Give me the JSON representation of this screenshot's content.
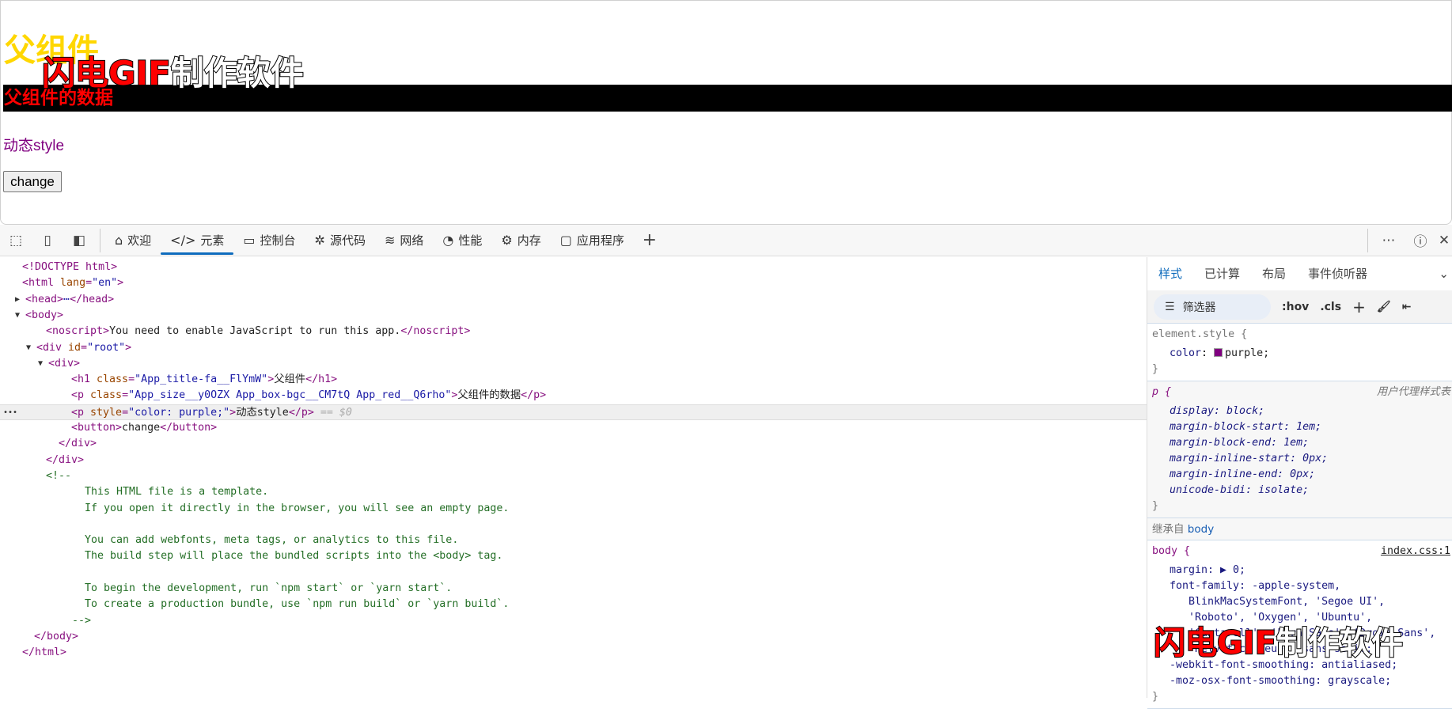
{
  "page": {
    "h1": "父组件",
    "box_text": "父组件的数据",
    "dynamic_text": "动态style",
    "button": "change"
  },
  "watermark": {
    "red": "闪电GIF",
    "white": "制作软件"
  },
  "toolbar": {
    "tabs": [
      {
        "label": "欢迎",
        "icon": "home-icon"
      },
      {
        "label": "元素",
        "icon": "code-icon",
        "active": true
      },
      {
        "label": "控制台",
        "icon": "console-icon"
      },
      {
        "label": "源代码",
        "icon": "bug-icon"
      },
      {
        "label": "网络",
        "icon": "wifi-icon"
      },
      {
        "label": "性能",
        "icon": "gauge-icon"
      },
      {
        "label": "内存",
        "icon": "chip-icon"
      },
      {
        "label": "应用程序",
        "icon": "app-icon"
      }
    ]
  },
  "dom": [
    {
      "i": 28,
      "s": [
        [
          "tag",
          "<!DOCTYPE html>"
        ]
      ]
    },
    {
      "i": 28,
      "s": [
        [
          "tag",
          "<html "
        ],
        [
          "attr",
          "lang"
        ],
        [
          "tag",
          "="
        ],
        [
          "val",
          "\"en\""
        ],
        [
          "tag",
          ">"
        ]
      ]
    },
    {
      "i": 32,
      "tri": "▶",
      "s": [
        [
          "tag",
          "<head>"
        ],
        [
          "val",
          "⋯"
        ],
        [
          "tag",
          "</head>"
        ]
      ]
    },
    {
      "i": 32,
      "tri": "▼",
      "s": [
        [
          "tag",
          "<body>"
        ]
      ]
    },
    {
      "i": 58,
      "s": [
        [
          "tag",
          "<noscript>"
        ],
        [
          "txt",
          "You need to enable JavaScript to run this app."
        ],
        [
          "tag",
          "</noscript>"
        ]
      ]
    },
    {
      "i": 46,
      "tri": "▼",
      "s": [
        [
          "tag",
          "<div "
        ],
        [
          "attr",
          "id"
        ],
        [
          "tag",
          "="
        ],
        [
          "val",
          "\"root\""
        ],
        [
          "tag",
          ">"
        ]
      ]
    },
    {
      "i": 61,
      "tri": "▼",
      "s": [
        [
          "tag",
          "<div>"
        ]
      ]
    },
    {
      "i": 90,
      "s": [
        [
          "tag",
          "<h1 "
        ],
        [
          "attr",
          "class"
        ],
        [
          "tag",
          "="
        ],
        [
          "val",
          "\"App_title-fa__FlYmW\""
        ],
        [
          "tag",
          ">"
        ],
        [
          "txt",
          "父组件"
        ],
        [
          "tag",
          "</h1>"
        ]
      ]
    },
    {
      "i": 90,
      "s": [
        [
          "tag",
          "<p "
        ],
        [
          "attr",
          "class"
        ],
        [
          "tag",
          "="
        ],
        [
          "val",
          "\"App_size__y0OZX App_box-bgc__CM7tQ App_red__Q6rho\""
        ],
        [
          "tag",
          ">"
        ],
        [
          "txt",
          "父组件的数据"
        ],
        [
          "tag",
          "</p>"
        ]
      ]
    },
    {
      "i": 90,
      "sel": true,
      "s": [
        [
          "tag",
          "<p "
        ],
        [
          "attr",
          "style"
        ],
        [
          "tag",
          "="
        ],
        [
          "val",
          "\"color: purple;\""
        ],
        [
          "tag",
          ">"
        ],
        [
          "txt",
          "动态style"
        ],
        [
          "tag",
          "</p>"
        ],
        [
          "dim",
          " == $0"
        ]
      ]
    },
    {
      "i": 90,
      "s": [
        [
          "tag",
          "<button>"
        ],
        [
          "txt",
          "change"
        ],
        [
          "tag",
          "</button>"
        ]
      ]
    },
    {
      "i": 74,
      "s": [
        [
          "tag",
          "</div>"
        ]
      ]
    },
    {
      "i": 58,
      "s": [
        [
          "tag",
          "</div>"
        ]
      ]
    },
    {
      "i": 58,
      "s": [
        [
          "cm",
          "<!--"
        ]
      ]
    },
    {
      "i": 107,
      "s": [
        [
          "cm",
          "This HTML file is a template."
        ]
      ]
    },
    {
      "i": 107,
      "s": [
        [
          "cm",
          "If you open it directly in the browser, you will see an empty page."
        ]
      ]
    },
    {
      "i": 107,
      "s": []
    },
    {
      "i": 107,
      "s": [
        [
          "cm",
          "You can add webfonts, meta tags, or analytics to this file."
        ]
      ]
    },
    {
      "i": 107,
      "s": [
        [
          "cm",
          "The build step will place the bundled scripts into the <body> tag."
        ]
      ]
    },
    {
      "i": 107,
      "s": []
    },
    {
      "i": 107,
      "s": [
        [
          "cm",
          "To begin the development, run `npm start` or `yarn start`."
        ]
      ]
    },
    {
      "i": 107,
      "s": [
        [
          "cm",
          "To create a production bundle, use `npm run build` or `yarn build`."
        ]
      ]
    },
    {
      "i": 91,
      "s": [
        [
          "cm",
          "-->"
        ]
      ]
    },
    {
      "i": 43,
      "s": [
        [
          "tag",
          "</body>"
        ]
      ]
    },
    {
      "i": 28,
      "s": [
        [
          "tag",
          "</html>"
        ]
      ]
    }
  ],
  "styles": {
    "tabs": [
      "样式",
      "已计算",
      "布局",
      "事件侦听器"
    ],
    "filter": "筛选器",
    "hov": ":hov",
    "cls": ".cls",
    "element_style": {
      "selector": "element.style {",
      "prop": "color",
      "value": "purple;",
      "swatch": "#800080"
    },
    "ua": {
      "selector": "p {",
      "source": "用户代理样式表",
      "props": [
        "display: block;",
        "margin-block-start: 1em;",
        "margin-block-end: 1em;",
        "margin-inline-start: 0px;",
        "margin-inline-end: 0px;",
        "unicode-bidi: isolate;"
      ]
    },
    "inherited_label": "继承自",
    "inherited_from": "body",
    "body": {
      "selector": "body {",
      "source": "index.css:1",
      "lines": [
        "margin: ▶ 0;",
        "font-family: -apple-system,",
        "   BlinkMacSystemFont, 'Segoe UI',",
        "   'Roboto', 'Oxygen', 'Ubuntu',",
        "   'Cantarell', 'Fira Sans', 'Droid Sans',",
        "   'Helvetica Neue', sans-serif;",
        "-webkit-font-smoothing: antialiased;",
        "-moz-osx-font-smoothing: grayscale;"
      ]
    },
    "close": "}"
  }
}
